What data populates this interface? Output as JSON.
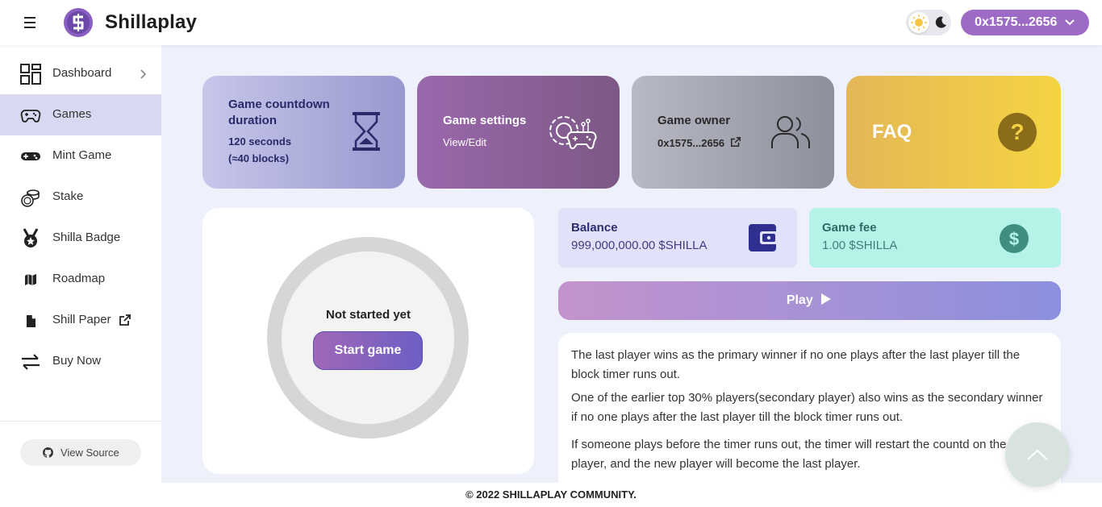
{
  "header": {
    "brand": "Shillaplay",
    "wallet_address": "0x1575...2656"
  },
  "sidebar": {
    "items": [
      {
        "label": "Dashboard",
        "icon": "dashboard-icon"
      },
      {
        "label": "Games",
        "icon": "gamepad-icon",
        "active": true
      },
      {
        "label": "Mint Game",
        "icon": "gamepad-solid-icon"
      },
      {
        "label": "Stake",
        "icon": "coins-icon"
      },
      {
        "label": "Shilla Badge",
        "icon": "medal-icon"
      },
      {
        "label": "Roadmap",
        "icon": "map-icon"
      },
      {
        "label": "Shill Paper",
        "icon": "file-icon"
      },
      {
        "label": "Buy Now",
        "icon": "exchange-icon"
      }
    ],
    "view_source": "View Source"
  },
  "cards": {
    "countdown": {
      "title": "Game countdown duration",
      "line1": "120 seconds",
      "line2": "(≈40 blocks)"
    },
    "settings": {
      "title": "Game settings",
      "sub": "View/Edit"
    },
    "owner": {
      "title": "Game owner",
      "address": "0x1575...2656"
    },
    "faq": {
      "title": "FAQ"
    }
  },
  "game": {
    "status": "Not started yet",
    "start_label": "Start game"
  },
  "balance": {
    "label": "Balance",
    "value": "999,000,000.00 $SHILLA"
  },
  "game_fee": {
    "label": "Game fee",
    "value": "1.00 $SHILLA"
  },
  "play_label": "Play",
  "rules": [
    "The last player wins as the primary winner if no one plays after the last player till the block timer runs out.",
    "One of the earlier top 30% players(secondary player) also wins as the secondary winner if no one plays after the last player till the block timer runs out.",
    "If someone plays before the timer runs out, the timer will restart the countd on the new player, and the new player will become the last player."
  ],
  "footer": "© 2022 SHILLAPLAY COMMUNITY.",
  "colors": {
    "accent": "#9d6bc5",
    "active_nav": "#d8d8f2",
    "balance_bg": "#e1e1fa",
    "fee_bg": "#b5f3e9"
  }
}
